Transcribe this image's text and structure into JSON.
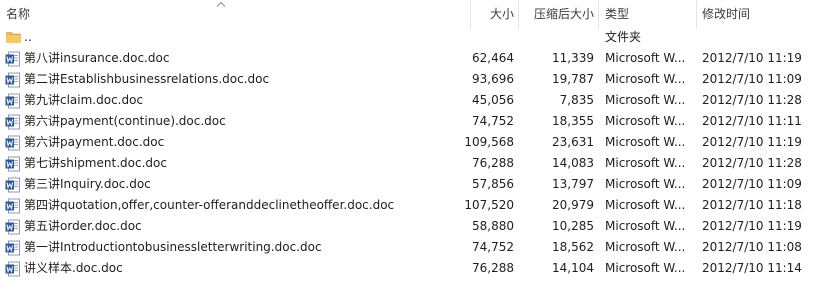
{
  "columns": {
    "name": "名称",
    "size": "大小",
    "compressed": "压缩后大小",
    "type": "类型",
    "modified": "修改时间"
  },
  "parent_row": {
    "name": "..",
    "type": "文件夹"
  },
  "files": [
    {
      "name": "第八讲insurance.doc.doc",
      "size": "62,464",
      "compressed": "11,339",
      "type": "Microsoft W...",
      "modified": "2012/7/10 11:19"
    },
    {
      "name": "第二讲Establishbusinessrelations.doc.doc",
      "size": "93,696",
      "compressed": "19,787",
      "type": "Microsoft W...",
      "modified": "2012/7/10 11:09"
    },
    {
      "name": "第九讲claim.doc.doc",
      "size": "45,056",
      "compressed": "7,835",
      "type": "Microsoft W...",
      "modified": "2012/7/10 11:28"
    },
    {
      "name": "第六讲payment(continue).doc.doc",
      "size": "74,752",
      "compressed": "18,355",
      "type": "Microsoft W...",
      "modified": "2012/7/10 11:11"
    },
    {
      "name": "第六讲payment.doc.doc",
      "size": "109,568",
      "compressed": "23,631",
      "type": "Microsoft W...",
      "modified": "2012/7/10 11:19"
    },
    {
      "name": "第七讲shipment.doc.doc",
      "size": "76,288",
      "compressed": "14,083",
      "type": "Microsoft W...",
      "modified": "2012/7/10 11:28"
    },
    {
      "name": "第三讲Inquiry.doc.doc",
      "size": "57,856",
      "compressed": "13,797",
      "type": "Microsoft W...",
      "modified": "2012/7/10 11:09"
    },
    {
      "name": "第四讲quotation,offer,counter-offeranddeclinetheoffer.doc.doc",
      "size": "107,520",
      "compressed": "20,979",
      "type": "Microsoft W...",
      "modified": "2012/7/10 11:18"
    },
    {
      "name": "第五讲order.doc.doc",
      "size": "58,880",
      "compressed": "10,285",
      "type": "Microsoft W...",
      "modified": "2012/7/10 11:19"
    },
    {
      "name": "第一讲Introductiontobusinessletterwriting.doc.doc",
      "size": "74,752",
      "compressed": "18,562",
      "type": "Microsoft W...",
      "modified": "2012/7/10 11:08"
    },
    {
      "name": "讲义样本.doc.doc",
      "size": "76,288",
      "compressed": "14,104",
      "type": "Microsoft W...",
      "modified": "2012/7/10 11:14"
    }
  ],
  "icons": {
    "file": "word-doc-icon",
    "folder": "folder-icon",
    "sort": "sort-ascending-icon"
  },
  "colors": {
    "word_blue": "#2b579a",
    "folder_yellow": "#e8b64a"
  }
}
